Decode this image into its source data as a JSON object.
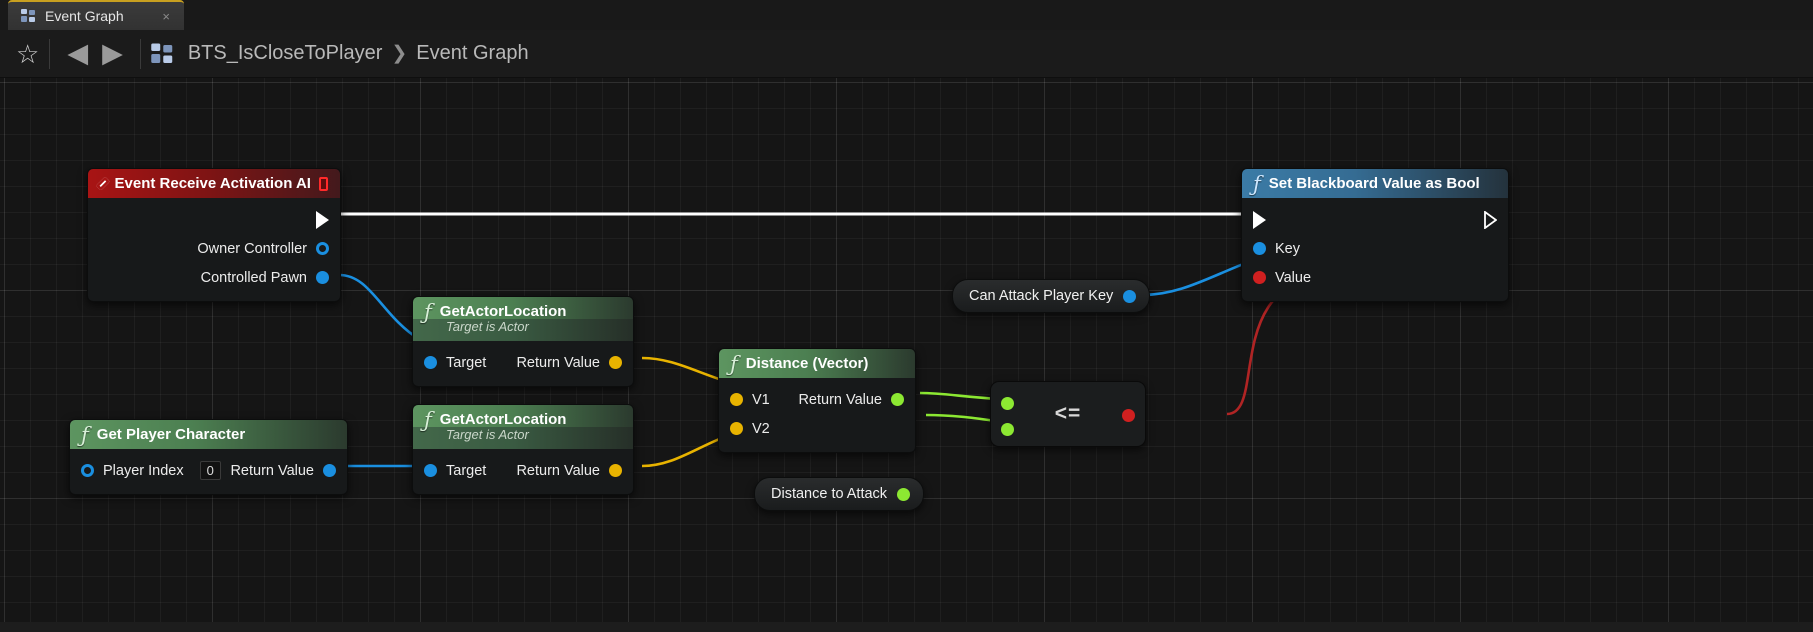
{
  "window": {
    "tab": {
      "label": "Event Graph",
      "icon": "blueprint-icon",
      "close": "×"
    }
  },
  "toolbar": {
    "star_icon": "☆",
    "back_icon": "◀",
    "forward_icon": "▶",
    "blueprint_icon": "blueprint-icon",
    "breadcrumb": {
      "root": "BTS_IsCloseToPlayer",
      "separator": "❯",
      "leaf": "Event Graph"
    }
  },
  "graph": {
    "nodes": [
      {
        "id": "event-receive-activation-ai",
        "title": "Event Receive Activation AI",
        "kind": "event",
        "icon": "event-diamond-icon",
        "delegate_icon": "delegate-square-icon",
        "outputs": [
          {
            "label": "",
            "type": "exec"
          },
          {
            "label": "Owner Controller",
            "type": "object"
          },
          {
            "label": "Controlled Pawn",
            "type": "object"
          }
        ]
      },
      {
        "id": "get-actor-location-1",
        "title": "GetActorLocation",
        "subtitle": "Target is Actor",
        "kind": "function",
        "icon": "function-f-icon",
        "inputs": [
          {
            "label": "Target",
            "type": "object"
          }
        ],
        "outputs": [
          {
            "label": "Return Value",
            "type": "vector"
          }
        ]
      },
      {
        "id": "get-player-character",
        "title": "Get Player Character",
        "kind": "function",
        "icon": "function-f-icon",
        "inputs": [
          {
            "label": "Player Index",
            "type": "int",
            "value": "0"
          }
        ],
        "outputs": [
          {
            "label": "Return Value",
            "type": "object"
          }
        ]
      },
      {
        "id": "get-actor-location-2",
        "title": "GetActorLocation",
        "subtitle": "Target is Actor",
        "kind": "function",
        "icon": "function-f-icon",
        "inputs": [
          {
            "label": "Target",
            "type": "object"
          }
        ],
        "outputs": [
          {
            "label": "Return Value",
            "type": "vector"
          }
        ]
      },
      {
        "id": "distance-vector",
        "title": "Distance (Vector)",
        "kind": "function",
        "icon": "function-f-icon",
        "inputs": [
          {
            "label": "V1",
            "type": "vector"
          },
          {
            "label": "V2",
            "type": "vector"
          }
        ],
        "outputs": [
          {
            "label": "Return Value",
            "type": "float"
          }
        ]
      },
      {
        "id": "less-equal-compare",
        "title": "<=",
        "kind": "compact-operator",
        "inputs": [
          {
            "type": "float"
          },
          {
            "type": "float"
          }
        ],
        "outputs": [
          {
            "type": "bool"
          }
        ]
      },
      {
        "id": "distance-to-attack",
        "title": "Distance to Attack",
        "kind": "variable-get",
        "pin_type": "float"
      },
      {
        "id": "can-attack-player-key",
        "title": "Can Attack Player Key",
        "kind": "variable-get",
        "pin_type": "object"
      },
      {
        "id": "set-blackboard-value-as-bool",
        "title": "Set Blackboard Value as Bool",
        "kind": "function",
        "icon": "function-f-icon",
        "inputs": [
          {
            "label": "",
            "type": "exec"
          },
          {
            "label": "Key",
            "type": "object"
          },
          {
            "label": "Value",
            "type": "bool"
          }
        ],
        "outputs": [
          {
            "label": "",
            "type": "exec"
          }
        ]
      }
    ],
    "pin_colors": {
      "exec": "#ffffff",
      "object": "#1a8fe0",
      "vector": "#e8b300",
      "float": "#8ce832",
      "bool": "#d02020",
      "int": "#3dd6a0"
    },
    "wires": [
      {
        "from": "event-receive-activation-ai.exec",
        "to": "set-blackboard-value-as-bool.exec",
        "color": "#ffffff"
      },
      {
        "from": "event-receive-activation-ai.ControlledPawn",
        "to": "get-actor-location-1.Target",
        "color": "#1a8fe0"
      },
      {
        "from": "get-player-character.ReturnValue",
        "to": "get-actor-location-2.Target",
        "color": "#1a8fe0"
      },
      {
        "from": "get-actor-location-1.ReturnValue",
        "to": "distance-vector.V1",
        "color": "#e8b300"
      },
      {
        "from": "get-actor-location-2.ReturnValue",
        "to": "distance-vector.V2",
        "color": "#e8b300"
      },
      {
        "from": "distance-vector.ReturnValue",
        "to": "less-equal-compare.A",
        "color": "#8ce832"
      },
      {
        "from": "distance-to-attack.out",
        "to": "less-equal-compare.B",
        "color": "#8ce832"
      },
      {
        "from": "less-equal-compare.out",
        "to": "set-blackboard-value-as-bool.Value",
        "color": "#b02424"
      },
      {
        "from": "can-attack-player-key.out",
        "to": "set-blackboard-value-as-bool.Key",
        "color": "#1a8fe0"
      }
    ]
  }
}
